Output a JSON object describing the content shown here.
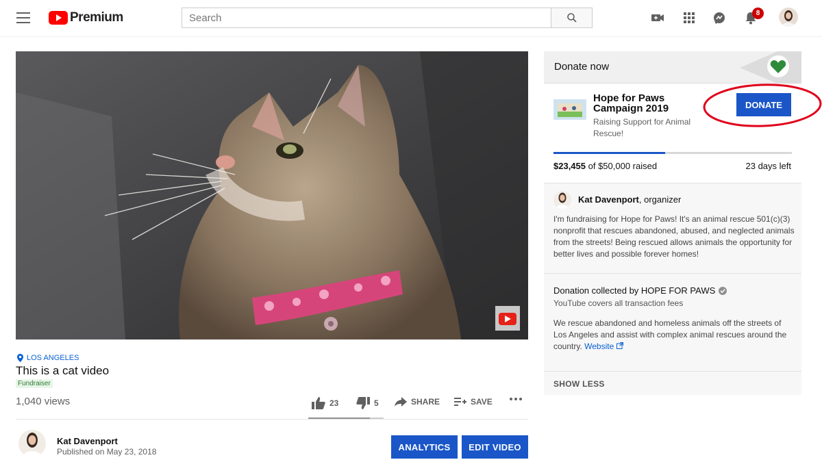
{
  "header": {
    "logo_text": "Premium",
    "search_placeholder": "Search",
    "notification_count": "8"
  },
  "video": {
    "location": "LOS ANGELES",
    "title": "This is a cat video",
    "tag": "Fundraiser",
    "views": "1,040 views",
    "likes": "23",
    "dislikes": "5",
    "share_label": "SHARE",
    "save_label": "SAVE",
    "like_ratio": 0.82
  },
  "channel": {
    "name": "Kat Davenport",
    "published": "Published on May 23, 2018",
    "analytics_label": "ANALYTICS",
    "edit_label": "EDIT VIDEO"
  },
  "donation": {
    "header": "Donate now",
    "campaign_title": "Hope for Paws Campaign 2019",
    "campaign_subtitle": "Raising Support for Animal Rescue!",
    "donate_label": "DONATE",
    "raised_amount": "$23,455",
    "raised_suffix": " of $50,000 raised",
    "days_left": "23 days left",
    "progress": 0.469,
    "organizer_name": "Kat Davenport",
    "organizer_role": ", organizer",
    "organizer_desc": "I'm fundraising for Hope for Paws! It's an animal rescue 501(c)(3) nonprofit that rescues abandoned, abused, and neglected animals from the streets! Being rescued allows animals the opportunity for better lives and possible forever homes!",
    "collected_by": "Donation collected by HOPE FOR PAWS",
    "fees_note": "YouTube covers all transaction fees",
    "org_desc": "We rescue abandoned and homeless animals off the streets of Los Angeles and assist with complex animal rescues around the country.",
    "website_label": "Website",
    "show_less_label": "SHOW LESS"
  },
  "colors": {
    "accent_blue": "#1a56c8",
    "youtube_red": "#ff0000",
    "annotation_red": "#e0001b"
  }
}
